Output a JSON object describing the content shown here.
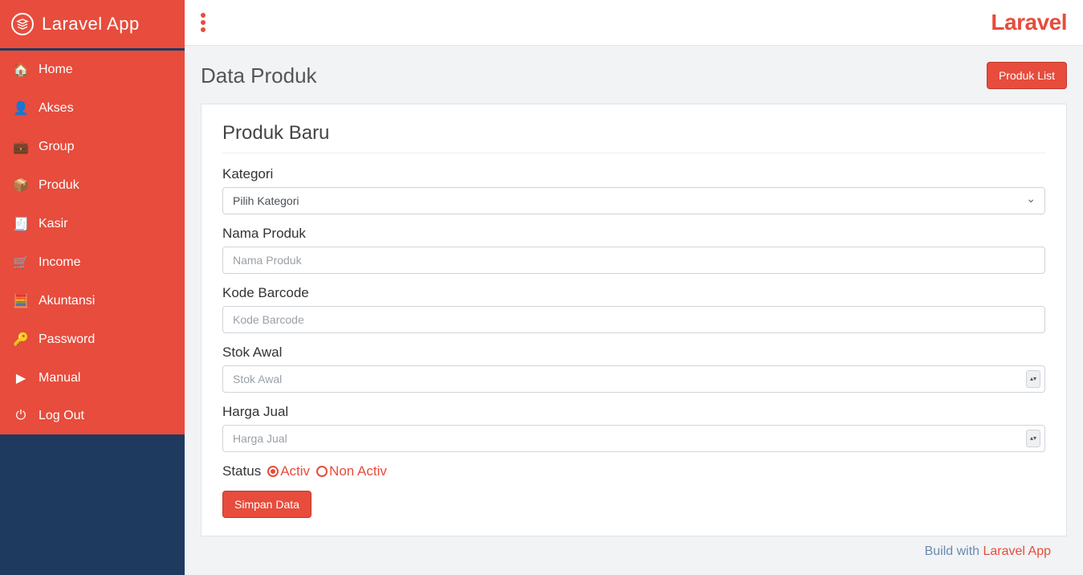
{
  "brand": {
    "sidebar_title": "Laravel App",
    "topbar_title": "Laravel"
  },
  "sidebar": {
    "items": [
      {
        "label": "Home",
        "icon": "home-icon"
      },
      {
        "label": "Akses",
        "icon": "user-icon"
      },
      {
        "label": "Group",
        "icon": "briefcase-icon"
      },
      {
        "label": "Produk",
        "icon": "box-open-icon"
      },
      {
        "label": "Kasir",
        "icon": "cash-register-icon"
      },
      {
        "label": "Income",
        "icon": "cart-icon"
      },
      {
        "label": "Akuntansi",
        "icon": "calculator-icon"
      },
      {
        "label": "Password",
        "icon": "key-icon"
      },
      {
        "label": "Manual",
        "icon": "play-icon"
      },
      {
        "label": "Log Out",
        "icon": "power-icon"
      }
    ]
  },
  "page": {
    "title": "Data Produk",
    "list_button": "Produk List"
  },
  "form": {
    "card_title": "Produk Baru",
    "fields": {
      "kategori": {
        "label": "Kategori",
        "placeholder": "Pilih Kategori"
      },
      "nama": {
        "label": "Nama Produk",
        "placeholder": "Nama Produk"
      },
      "barcode": {
        "label": "Kode Barcode",
        "placeholder": "Kode Barcode"
      },
      "stok": {
        "label": "Stok Awal",
        "placeholder": "Stok Awal"
      },
      "harga": {
        "label": "Harga Jual",
        "placeholder": "Harga Jual"
      }
    },
    "status": {
      "label": "Status",
      "options": {
        "active": "Activ",
        "nonactive": "Non Activ"
      },
      "selected": "active"
    },
    "submit_label": "Simpan Data"
  },
  "footer": {
    "prefix": "Build with ",
    "accent": "Laravel App"
  },
  "icon_glyphs": {
    "home-icon": "🏠",
    "user-icon": "👤",
    "briefcase-icon": "💼",
    "box-open-icon": "📦",
    "cash-register-icon": "🧾",
    "cart-icon": "🛒",
    "calculator-icon": "🧮",
    "key-icon": "🔑",
    "play-icon": "▶",
    "power-icon": "⏻"
  }
}
